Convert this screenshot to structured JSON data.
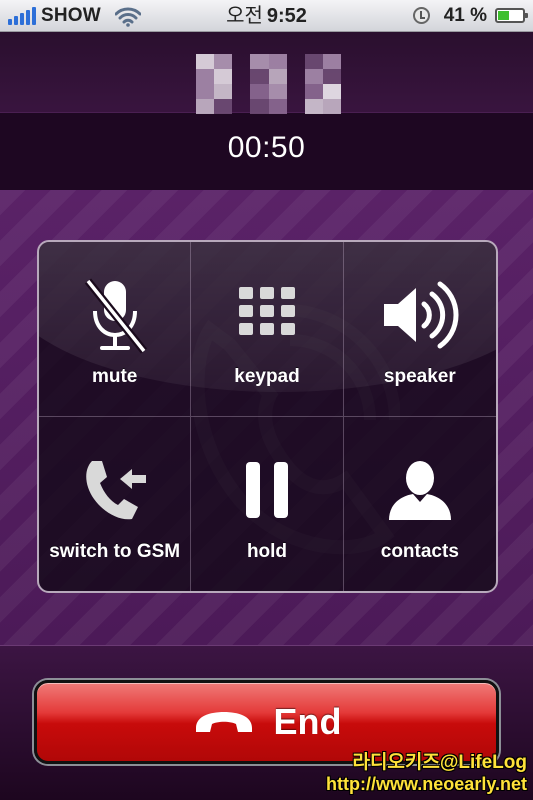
{
  "status_bar": {
    "carrier": "SHOW",
    "time_ampm": "오전",
    "time": "9:52",
    "battery_percent_label": "41 %",
    "battery_level": 0.41,
    "signal_bars": 5,
    "icons": [
      "signal-icon",
      "wifi-icon",
      "alarm-icon",
      "battery-icon"
    ]
  },
  "call": {
    "timer": "00:50"
  },
  "buttons": [
    {
      "label": "mute",
      "icon": "mic-muted-icon"
    },
    {
      "label": "keypad",
      "icon": "keypad-icon"
    },
    {
      "label": "speaker",
      "icon": "speaker-icon"
    },
    {
      "label": "switch to GSM",
      "icon": "phone-switch-icon"
    },
    {
      "label": "hold",
      "icon": "pause-icon"
    },
    {
      "label": "contacts",
      "icon": "person-icon"
    }
  ],
  "end_button": {
    "label": "End",
    "icon": "hangup-icon"
  },
  "watermark": {
    "line1": "라디오키즈@LifeLog",
    "line2": "http://www.neoearly.net"
  },
  "colors": {
    "accent_purple": "#5a2267",
    "end_red": "#c80b0b",
    "status_bar_bg": "#d3d5da",
    "watermark_yellow": "#ffe23a"
  }
}
